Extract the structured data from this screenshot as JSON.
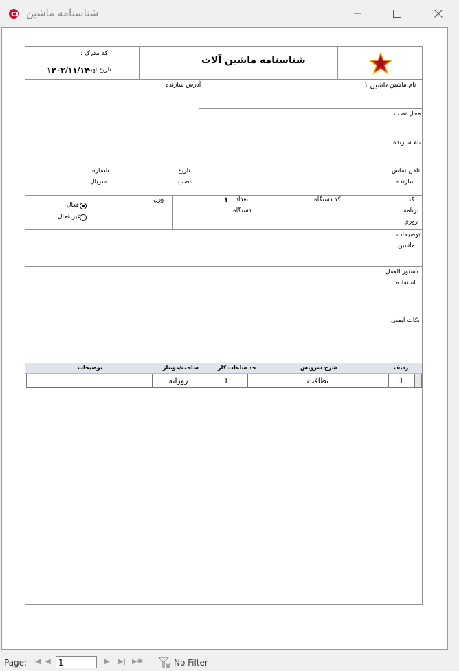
{
  "window": {
    "title": "شناسنامه ماشین"
  },
  "report": {
    "title": "شناسنامه ماشین آلات",
    "doc_code_label": "کد مدرک :",
    "prep_date_label": "تاریخ تهیه :",
    "prep_date_value": "۱۴۰۲/۱۱/۱۴",
    "machine_name_label": "نام ماشین",
    "machine_name_value": "ماشین ۱",
    "maker_address_label": "آدرس سازنده",
    "install_place_label": "محل نصب",
    "maker_name_label": "نام سازنده",
    "maker_phone_label_1": "تلفن تماس",
    "maker_phone_label_2": "سازنده",
    "install_date_label_1": "تاریخ",
    "install_date_label_2": "نصب",
    "serial_label_1": "شماره",
    "serial_label_2": "سریال",
    "program_code_label_1": "کد",
    "program_code_label_2": "برنامه",
    "program_code_label_3": "روزی",
    "device_code_label": "کد دستگاه",
    "device_count_label_1": "تعداد",
    "device_count_label_2": "دستگاه",
    "device_count_value": "۱",
    "weight_label": "وزن",
    "active_label": "فعال",
    "inactive_label": "غیر فعال",
    "desc_label_1": "توضیحات",
    "desc_label_2": "ماشین",
    "instructions_label_1": "دستور العمل",
    "instructions_label_2": "استفاده",
    "safety_label": "نکات ایمنی"
  },
  "services": {
    "columns": [
      "ردیف",
      "شرح سرویس",
      "حد ساعات کار",
      "ساخت/مونتاژ",
      "توضیحات"
    ],
    "rows": [
      {
        "index": "1",
        "description": "نظافت",
        "hours": "1",
        "build": "روزانه",
        "notes": ""
      }
    ]
  },
  "statusbar": {
    "page_label": "Page:",
    "page_value": "1",
    "filter_label": "No Filter"
  }
}
